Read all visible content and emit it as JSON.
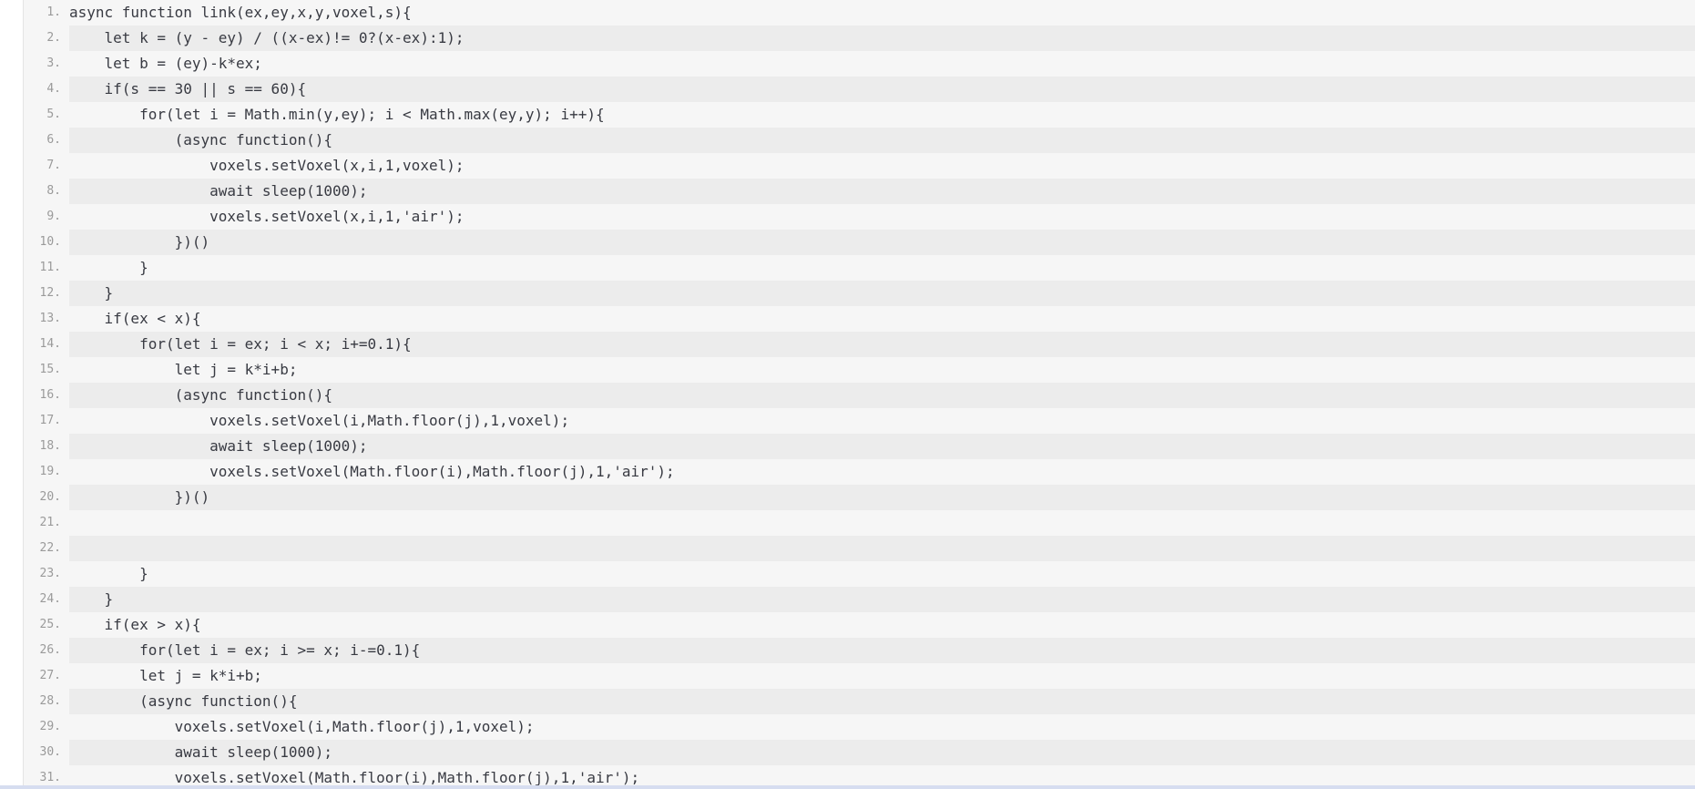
{
  "code": {
    "lines": [
      {
        "number": "1.",
        "text": "async function link(ex,ey,x,y,voxel,s){"
      },
      {
        "number": "2.",
        "text": "    let k = (y - ey) / ((x-ex)!= 0?(x-ex):1);"
      },
      {
        "number": "3.",
        "text": "    let b = (ey)-k*ex;"
      },
      {
        "number": "4.",
        "text": "    if(s == 30 || s == 60){"
      },
      {
        "number": "5.",
        "text": "        for(let i = Math.min(y,ey); i < Math.max(ey,y); i++){"
      },
      {
        "number": "6.",
        "text": "            (async function(){"
      },
      {
        "number": "7.",
        "text": "                voxels.setVoxel(x,i,1,voxel);"
      },
      {
        "number": "8.",
        "text": "                await sleep(1000);"
      },
      {
        "number": "9.",
        "text": "                voxels.setVoxel(x,i,1,'air');"
      },
      {
        "number": "10.",
        "text": "            })()"
      },
      {
        "number": "11.",
        "text": "        }"
      },
      {
        "number": "12.",
        "text": "    }"
      },
      {
        "number": "13.",
        "text": "    if(ex < x){"
      },
      {
        "number": "14.",
        "text": "        for(let i = ex; i < x; i+=0.1){"
      },
      {
        "number": "15.",
        "text": "            let j = k*i+b;"
      },
      {
        "number": "16.",
        "text": "            (async function(){"
      },
      {
        "number": "17.",
        "text": "                voxels.setVoxel(i,Math.floor(j),1,voxel);"
      },
      {
        "number": "18.",
        "text": "                await sleep(1000);"
      },
      {
        "number": "19.",
        "text": "                voxels.setVoxel(Math.floor(i),Math.floor(j),1,'air');"
      },
      {
        "number": "20.",
        "text": "            })()"
      },
      {
        "number": "21.",
        "text": ""
      },
      {
        "number": "22.",
        "text": ""
      },
      {
        "number": "23.",
        "text": "        }"
      },
      {
        "number": "24.",
        "text": "    }"
      },
      {
        "number": "25.",
        "text": "    if(ex > x){"
      },
      {
        "number": "26.",
        "text": "        for(let i = ex; i >= x; i-=0.1){"
      },
      {
        "number": "27.",
        "text": "        let j = k*i+b;"
      },
      {
        "number": "28.",
        "text": "        (async function(){"
      },
      {
        "number": "29.",
        "text": "            voxels.setVoxel(i,Math.floor(j),1,voxel);"
      },
      {
        "number": "30.",
        "text": "            await sleep(1000);"
      },
      {
        "number": "31.",
        "text": "            voxels.setVoxel(Math.floor(i),Math.floor(j),1,'air');"
      }
    ]
  }
}
